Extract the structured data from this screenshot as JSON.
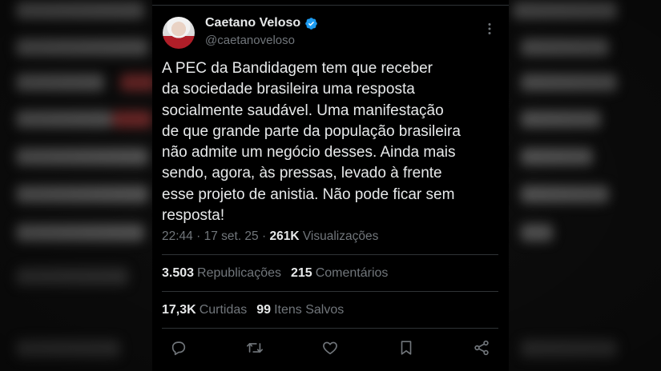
{
  "tweet": {
    "author_name": "Caetano Veloso",
    "author_handle": "@caetanoveloso",
    "text": "A PEC da Bandidagem tem que receber\nda sociedade brasileira uma resposta\nsocialmente saudável. Uma manifestação\nde que grande parte da população brasileira\nnão admite um negócio desses. Ainda mais\nsendo, agora, às pressas, levado à frente\nesse projeto de anistia. Não pode ficar sem\nresposta!",
    "time": "22:44",
    "separator": "·",
    "date": "17 set. 25",
    "separator2": "·",
    "views_count": "261K",
    "views_label": "Visualizações",
    "reposts_count": "3.503",
    "reposts_label": "Republicações",
    "comments_count": "215",
    "comments_label": "Comentários",
    "likes_count": "17,3K",
    "likes_label": "Curtidas",
    "saves_count": "99",
    "saves_label": "Itens Salvos"
  },
  "icons": {
    "verified": "verified-badge-icon",
    "more": "more-options-icon",
    "reply": "reply-icon",
    "repost": "repost-icon",
    "like": "like-icon",
    "bookmark": "bookmark-icon",
    "share": "share-icon"
  },
  "colors": {
    "background": "#000000",
    "text": "#e7e9ea",
    "secondary_text": "#71767b",
    "divider": "#2f3336",
    "verified": "#1d9bf0"
  }
}
